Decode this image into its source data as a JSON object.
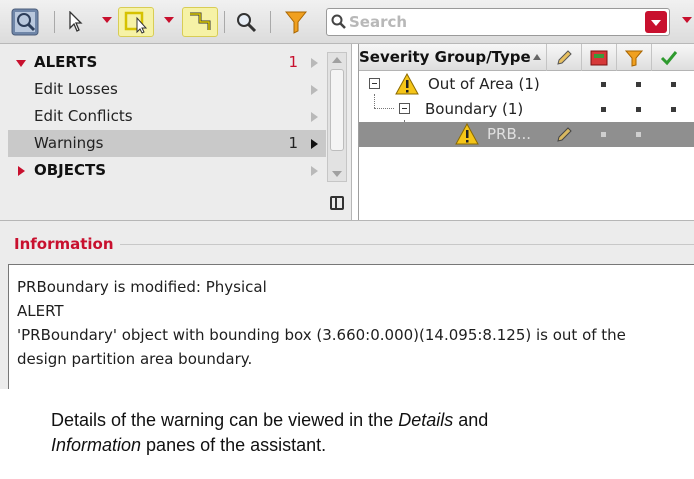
{
  "toolbar": {
    "search": {
      "placeholder": "Search"
    },
    "icons": [
      "target-view-icon",
      "select-arrow-icon",
      "edit-box-icon",
      "step-icon",
      "zoom-icon",
      "filter-icon"
    ],
    "highlight_color": "#f6f2a6",
    "accent_color": "#c8102e"
  },
  "categories": [
    {
      "label": "ALERTS",
      "count": "1",
      "section": true,
      "expanded": true
    },
    {
      "label": "Edit Losses",
      "count": "",
      "section": false
    },
    {
      "label": "Edit Conflicts",
      "count": "",
      "section": false
    },
    {
      "label": "Warnings",
      "count": "1",
      "section": false,
      "selected": true
    },
    {
      "label": "OBJECTS",
      "count": "",
      "section": true,
      "expanded": false
    }
  ],
  "tree": {
    "column_title": "Severity Group/Type",
    "column_icons": [
      "pencil-icon",
      "modified-flag-icon",
      "filter-icon",
      "check-icon"
    ],
    "rows": [
      {
        "label": "Out of Area (1)",
        "icon": "warning-icon"
      },
      {
        "label": "Boundary (1)",
        "icon": ""
      },
      {
        "label": "PRB...",
        "icon": "warning-icon",
        "selected": true
      }
    ]
  },
  "information": {
    "title": "Information",
    "lines": [
      "PRBoundary is modified: Physical",
      "ALERT",
      "'PRBoundary' object with bounding box (3.660:0.000)(14.095:8.125) is out of the",
      "design partition area boundary."
    ]
  },
  "caption": {
    "part1": "Details of the warning can be viewed in the ",
    "emph1": "Details",
    "part2": " and",
    "emph2": "Information",
    "part3": " panes of the assistant."
  }
}
